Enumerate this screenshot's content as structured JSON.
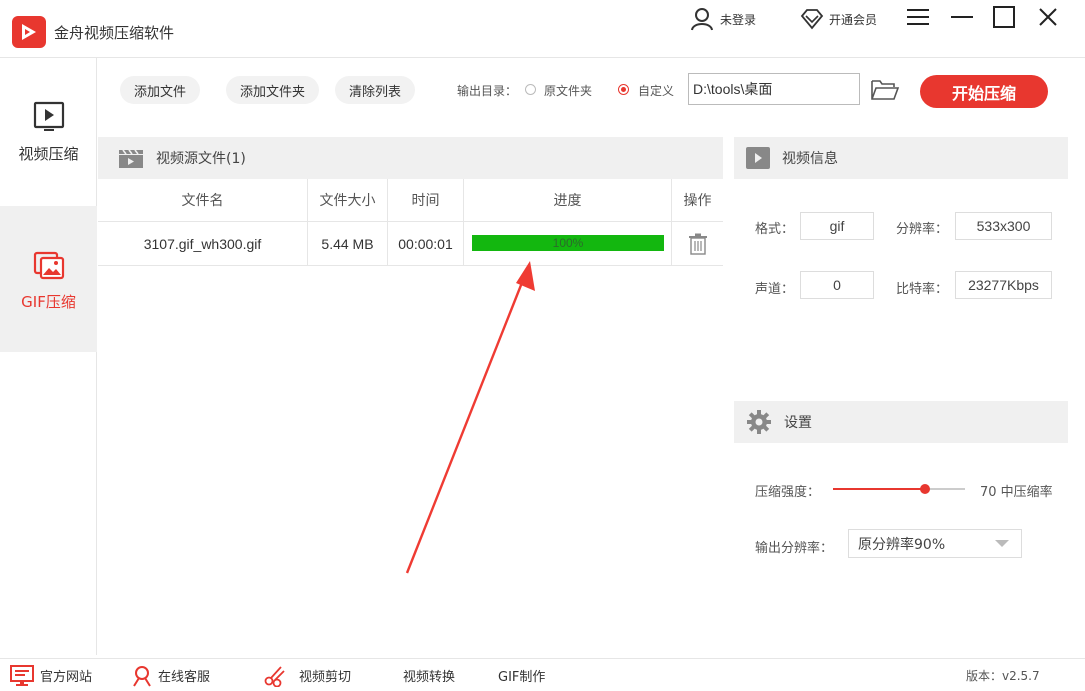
{
  "app": {
    "title": "金舟视频压缩软件"
  },
  "header": {
    "login_label": "未登录",
    "vip_label": "开通会员"
  },
  "sidebar": {
    "items": [
      {
        "label": "视频压缩",
        "icon": "video-play-icon",
        "active": false
      },
      {
        "label": "GIF压缩",
        "icon": "gif-image-icon",
        "active": true
      }
    ]
  },
  "toolbar": {
    "add_file_label": "添加文件",
    "add_folder_label": "添加文件夹",
    "clear_list_label": "清除列表",
    "output_dir_label": "输出目录：",
    "option_source": "原文件夹",
    "option_custom": "自定义",
    "selected_option": "custom",
    "path_value": "D:\\tools\\桌面",
    "start_label": "开始压缩"
  },
  "file_list": {
    "title": "视频源文件(1)",
    "columns": [
      "文件名",
      "文件大小",
      "时间",
      "进度",
      "操作"
    ],
    "rows": [
      {
        "name": "3107.gif_wh300.gif",
        "size": "5.44 MB",
        "time": "00:00:01",
        "progress": 100,
        "progress_label": "100%"
      }
    ]
  },
  "video_info": {
    "title": "视频信息",
    "format_label": "格式：",
    "format_value": "gif",
    "resolution_label": "分辨率：",
    "resolution_value": "533x300",
    "channel_label": "声道：",
    "channel_value": "0",
    "bitrate_label": "比特率：",
    "bitrate_value": "23277Kbps"
  },
  "settings": {
    "title": "设置",
    "strength_label": "压缩强度：",
    "strength_value": 70,
    "strength_text": "70 中压缩率",
    "output_res_label": "输出分辨率：",
    "output_res_value": "原分辨率90%"
  },
  "footer": {
    "items": [
      {
        "label": "官方网站",
        "icon": "monitor-icon"
      },
      {
        "label": "在线客服",
        "icon": "support-icon"
      },
      {
        "label": "视频剪切",
        "icon": "scissors-icon"
      },
      {
        "label": "视频转换",
        "icon": ""
      },
      {
        "label": "GIF制作",
        "icon": ""
      }
    ],
    "version": "版本：v2.5.7"
  },
  "colors": {
    "accent": "#e8372f",
    "progress": "#13b70f",
    "panel_bg": "#f0f0f0"
  }
}
